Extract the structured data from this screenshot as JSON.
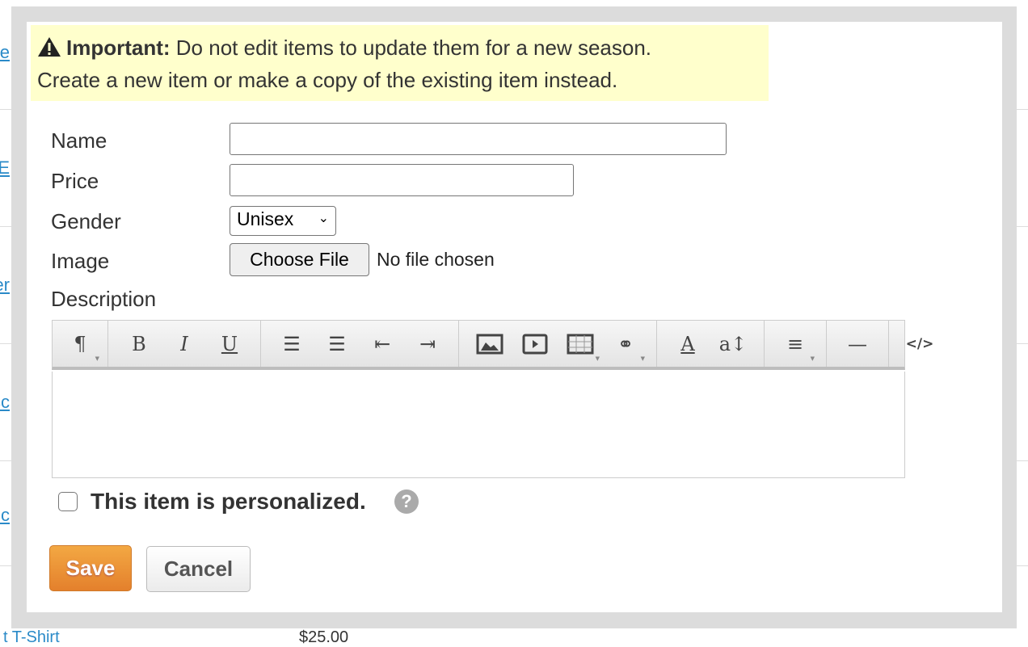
{
  "background": {
    "links": [
      "e",
      "EE",
      "er",
      "sc",
      "nc"
    ],
    "bottom_row": {
      "name": "t T-Shirt",
      "price": "$25.00"
    }
  },
  "notice": {
    "icon": "warning-triangle-icon",
    "strong": "Important:",
    "line1": "Do not edit items to update them for a new season.",
    "line2": "Create a new item or make a copy of the existing item instead."
  },
  "form": {
    "name_label": "Name",
    "name_value": "",
    "price_label": "Price",
    "price_value": "",
    "gender_label": "Gender",
    "gender_value": "Unisex",
    "image_label": "Image",
    "choose_file": "Choose File",
    "no_file": "No file chosen",
    "description_label": "Description",
    "toolbar": [
      [
        "paragraph-icon"
      ],
      [
        "bold-icon",
        "italic-icon",
        "underline-icon"
      ],
      [
        "unordered-list-icon",
        "ordered-list-icon",
        "outdent-icon",
        "indent-icon"
      ],
      [
        "image-icon",
        "video-icon",
        "table-icon",
        "link-icon"
      ],
      [
        "font-color-icon",
        "font-size-icon"
      ],
      [
        "align-icon"
      ],
      [
        "horizontal-rule-icon"
      ],
      [
        "html-code-icon"
      ]
    ],
    "personalized_label": "This item is personalized.",
    "personalized_checked": false,
    "help": "?",
    "save": "Save",
    "cancel": "Cancel"
  },
  "colors": {
    "notice_bg": "#ffffcc",
    "save_bg": "#e98b33",
    "link": "#2a8ac8"
  }
}
